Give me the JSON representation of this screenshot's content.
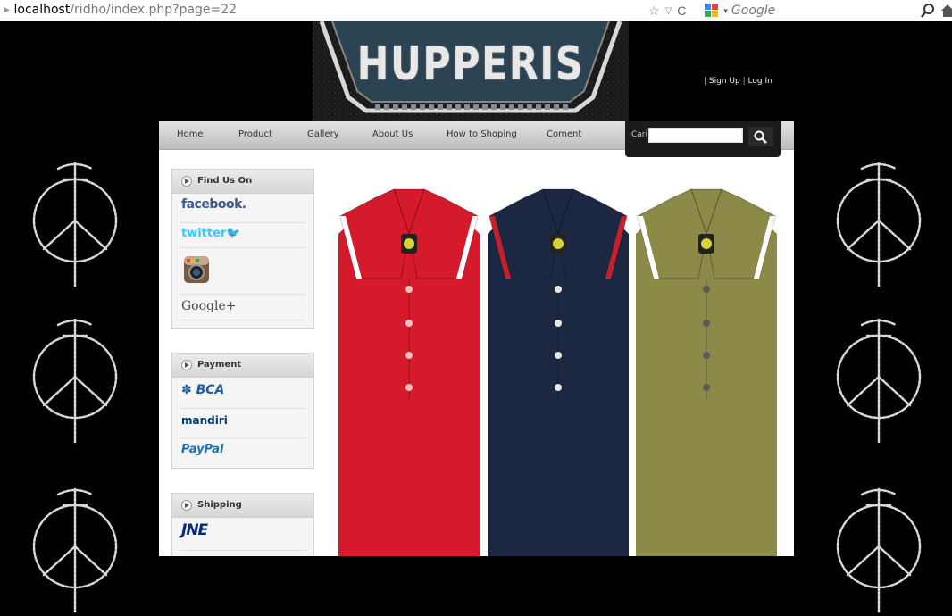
{
  "browser": {
    "url_host": "localhost",
    "url_path": "/ridho/index.php?page=22",
    "search_engine": "Google"
  },
  "header": {
    "brand": "HUPPERIS",
    "sign_up": "Sign Up",
    "log_in": "Log In",
    "separator": "|"
  },
  "nav": {
    "items": [
      {
        "label": "Home"
      },
      {
        "label": "Product"
      },
      {
        "label": "Gallery"
      },
      {
        "label": "About Us"
      },
      {
        "label": "How to Shoping"
      },
      {
        "label": "Coment"
      }
    ]
  },
  "search": {
    "label": "Cari",
    "value": ""
  },
  "sidebar": {
    "find_us": {
      "title": "Find Us On",
      "items": [
        {
          "label": "facebook."
        },
        {
          "label": "twitter"
        },
        {
          "label": "Instagram",
          "icon": "instagram-icon"
        },
        {
          "label": "Google+"
        }
      ]
    },
    "payment": {
      "title": "Payment",
      "items": [
        {
          "label": "BCA"
        },
        {
          "label": "mandiri"
        },
        {
          "label": "PayPal"
        }
      ]
    },
    "shipping": {
      "title": "Shipping",
      "items": [
        {
          "label": "JNE"
        }
      ]
    }
  },
  "products": [
    {
      "color": "#d51a2c",
      "collar_trim": "#ffffff",
      "button": "#e8c2c2"
    },
    {
      "color": "#1c2842",
      "collar_trim": "#c8202a",
      "button": "#e8e8e0"
    },
    {
      "color": "#8c8a48",
      "collar_trim": "#ffffff",
      "button": "#5a5a5a"
    }
  ],
  "colors": {
    "background": "#000000",
    "page": "#ffffff",
    "nav_gradient_top": "#e3e3e3",
    "search_panel": "#1b1b1b"
  }
}
